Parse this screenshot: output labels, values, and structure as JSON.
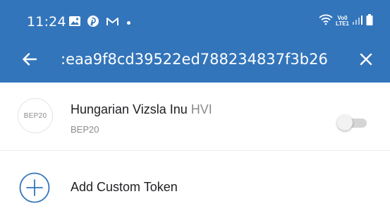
{
  "status_bar": {
    "time": "11:24",
    "left_icons": [
      "gallery-icon",
      "pinterest-icon",
      "gmail-icon",
      "notification-dot"
    ],
    "right_icons": [
      "wifi-icon",
      "volte-icon",
      "signal-icon",
      "battery-icon"
    ],
    "volte_line1": "Vo0",
    "volte_line2": "LTE1"
  },
  "toolbar": {
    "background_color": "#3375bb",
    "back_icon": "arrow-left-icon",
    "search_value": ":eaa9f8cd39522ed788234837f3b26",
    "close_icon": "close-icon"
  },
  "token": {
    "logo_text": "BEP20",
    "name": "Hungarian Vizsla Inu",
    "symbol": "HVI",
    "network": "BEP20",
    "enabled": false
  },
  "add_custom": {
    "icon": "plus-circle-icon",
    "label": "Add Custom Token",
    "accent_color": "#3375bb"
  }
}
